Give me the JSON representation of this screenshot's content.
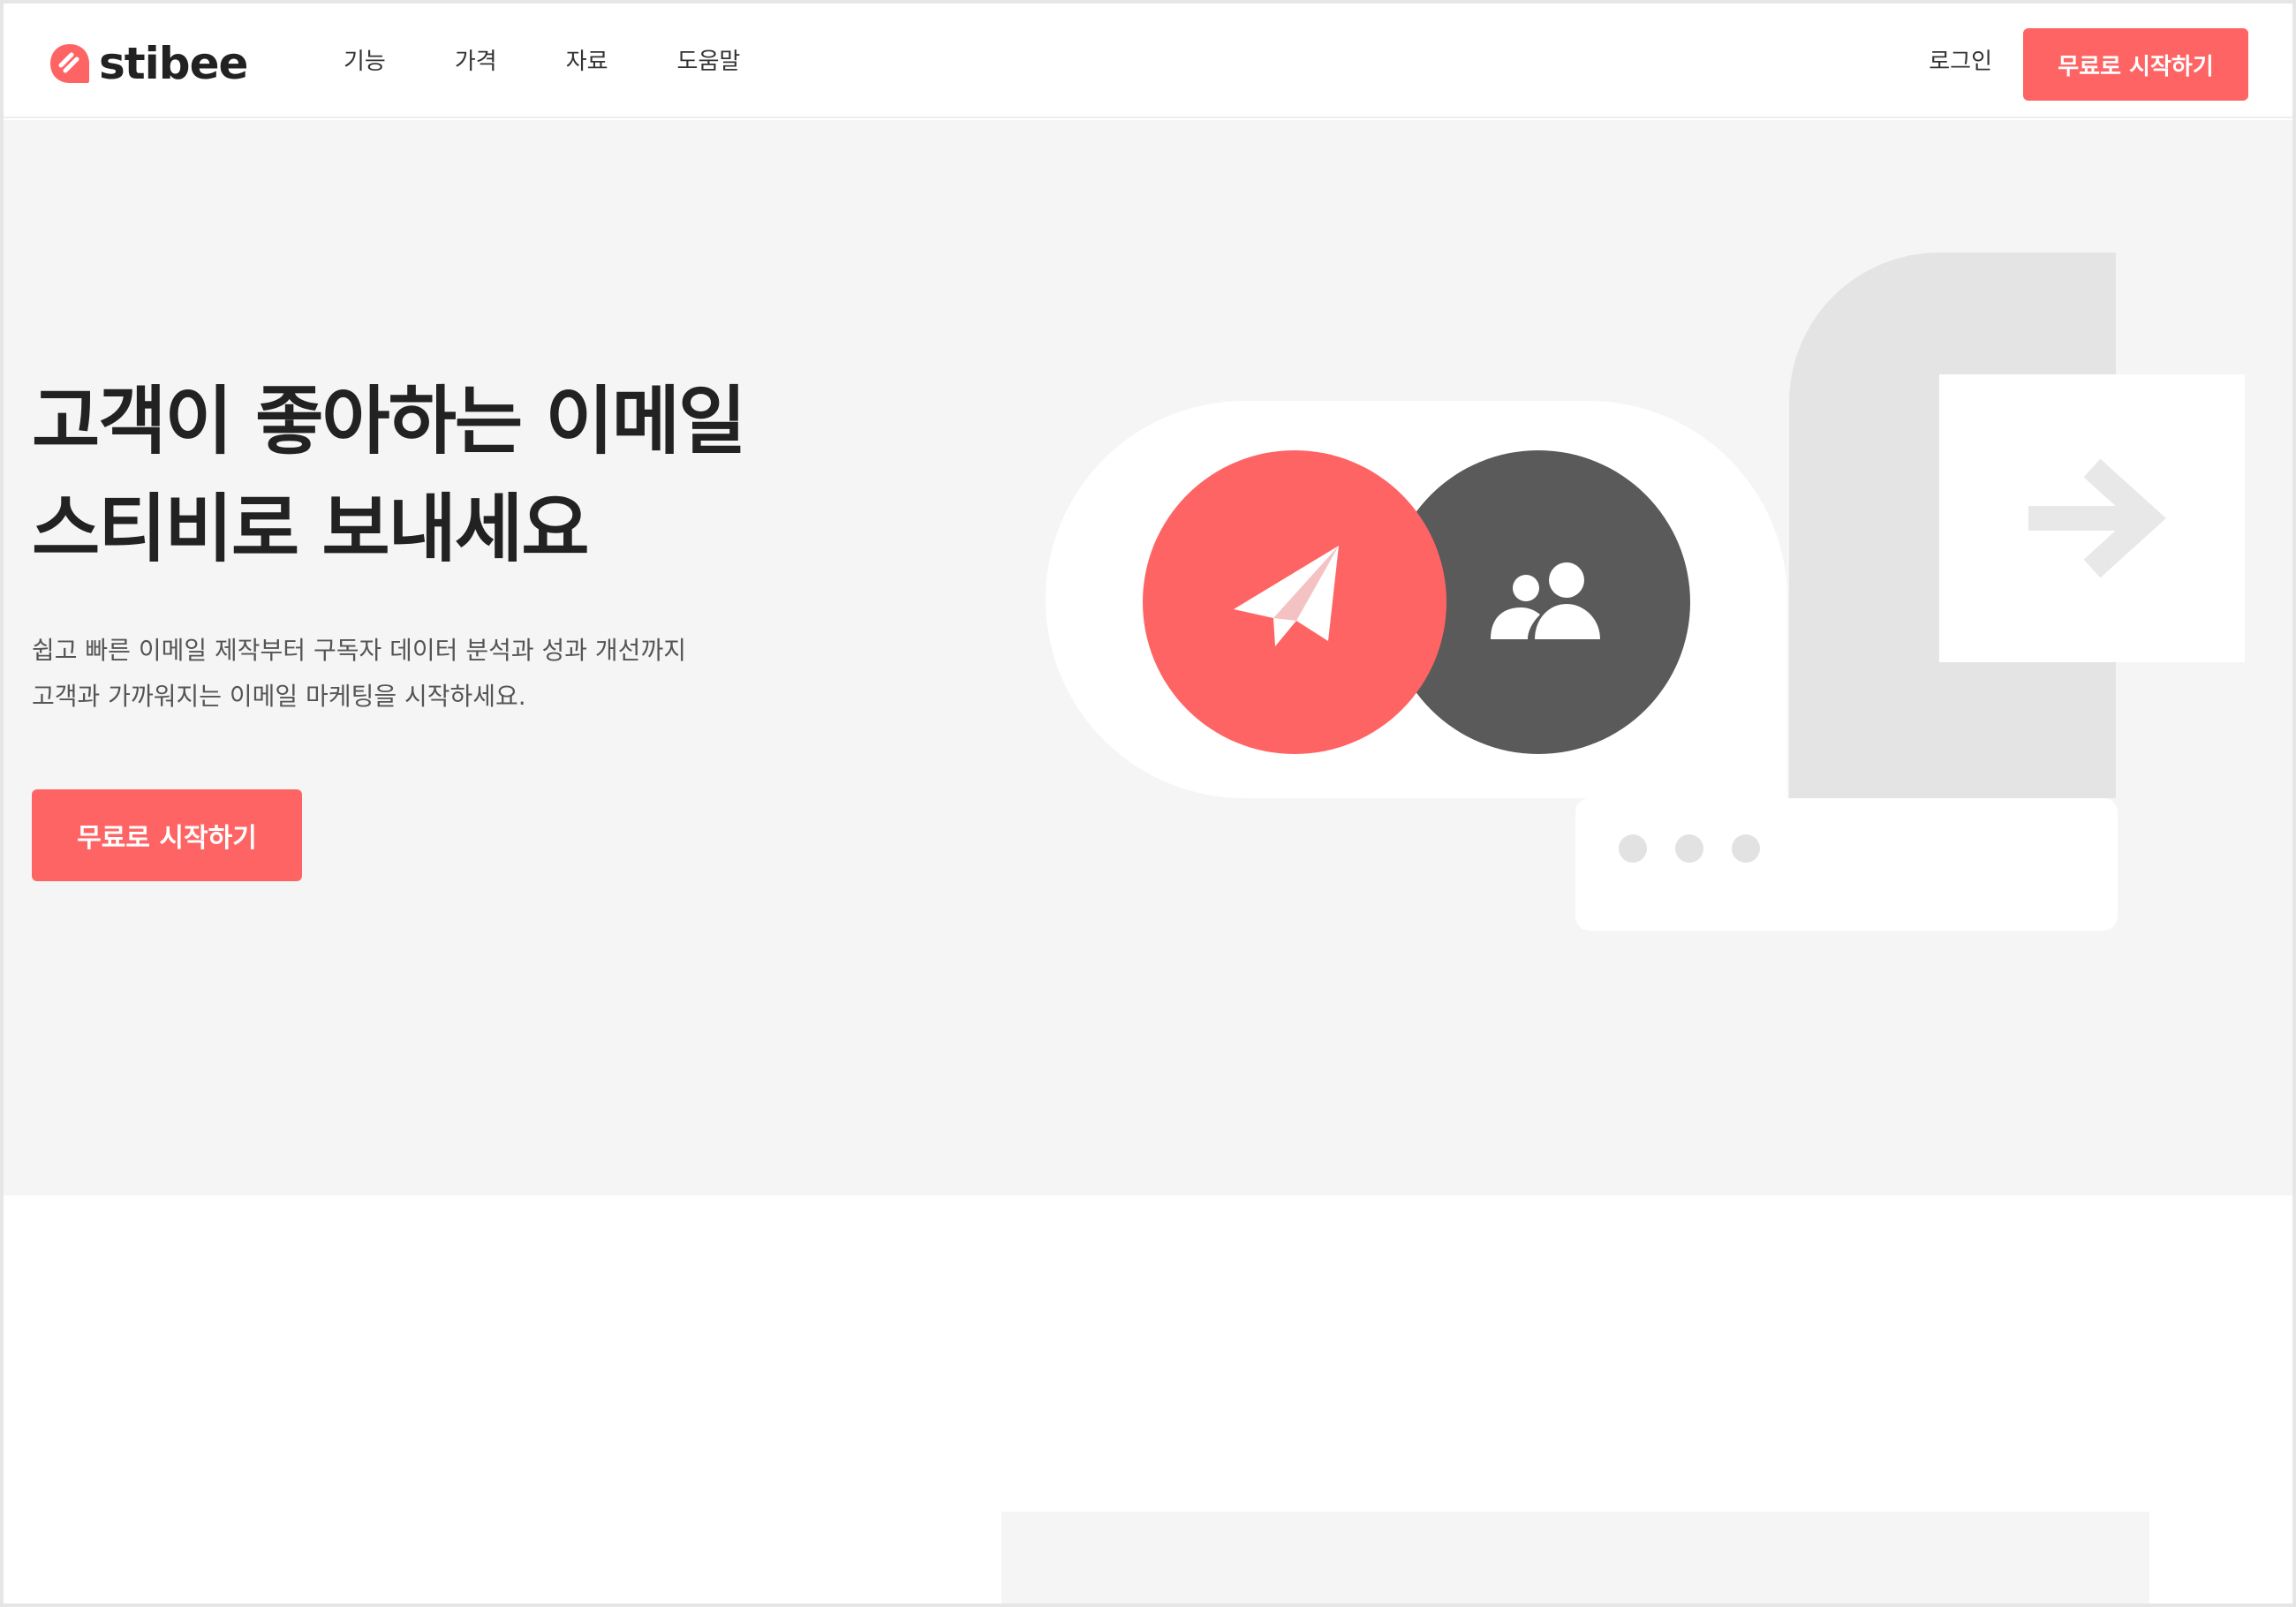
{
  "brand": {
    "name": "stibee",
    "accent_color": "#ff6464",
    "dark_color": "#5a5a5a"
  },
  "nav": {
    "items": [
      {
        "label": "기능"
      },
      {
        "label": "가격"
      },
      {
        "label": "자료"
      },
      {
        "label": "도움말"
      }
    ],
    "login_label": "로그인",
    "cta_label": "무료로 시작하기"
  },
  "hero": {
    "title_line1": "고객이 좋아하는 이메일",
    "title_line2": "스티비로 보내세요",
    "desc_line1": "쉽고 빠른 이메일 제작부터 구독자 데이터 분석과 성과 개선까지",
    "desc_line2": "고객과 가까워지는 이메일 마케팅을 시작하세요.",
    "cta_label": "무료로 시작하기"
  },
  "illustration": {
    "icons": [
      "paper-plane-icon",
      "users-icon",
      "arrow-right-icon"
    ]
  }
}
